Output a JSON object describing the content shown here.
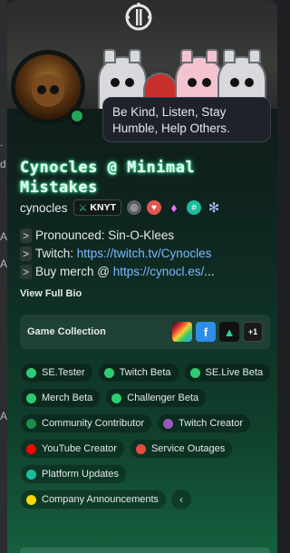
{
  "profile": {
    "custom_status": "Be Kind, Listen, Stay Humble, Help Others.",
    "display_name": "Cynocles @ Minimal Mistakes",
    "username": "cynocles",
    "server_tag": "KNYT",
    "online_status_color": "#23a55a",
    "bio": {
      "prefix": ">",
      "line1": "Pronounced: Sin-O-Klees",
      "line2_label": "Twitch: ",
      "line2_link": "https://twitch.tv/Cynocles",
      "line3_label": "Buy merch @ ",
      "line3_link": "https://cynocl.es/",
      "line3_ellipsis": "..."
    },
    "view_full_bio": "View Full Bio"
  },
  "game_collection": {
    "label": "Game Collection",
    "more_count": "+1",
    "games": [
      {
        "icon": "colorful-game-icon"
      },
      {
        "icon": "f-logo-game-icon"
      },
      {
        "icon": "triangle-game-icon"
      }
    ]
  },
  "roles": [
    {
      "name": "SE.Tester",
      "color": "#2ecc71"
    },
    {
      "name": "Twitch Beta",
      "color": "#2ecc71"
    },
    {
      "name": "SE.Live Beta",
      "color": "#2ecc71"
    },
    {
      "name": "Merch Beta",
      "color": "#2ecc71"
    },
    {
      "name": "Challenger Beta",
      "color": "#2ecc71"
    },
    {
      "name": "Community Contributor",
      "color": "#1f8b4c"
    },
    {
      "name": "Twitch Creator",
      "color": "#9b59b6"
    },
    {
      "name": "YouTube Creator",
      "color": "#ff0000"
    },
    {
      "name": "Service Outages",
      "color": "#e74c3c"
    },
    {
      "name": "Platform Updates",
      "color": "#1abc9c"
    },
    {
      "name": "Company Announcements",
      "color": "#ffd700"
    }
  ],
  "edge_text": [
    ".",
    "d",
    "A",
    "A",
    "A"
  ]
}
